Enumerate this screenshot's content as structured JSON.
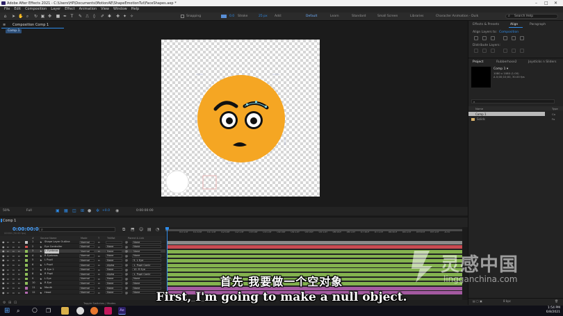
{
  "window": {
    "title": "Adobe After Effects 2021 - C:\\Users\\HP\\Documents\\MotionAE\\ShapeEmotionTut\\FaceShapes.aep *"
  },
  "menu": [
    "File",
    "Edit",
    "Composition",
    "Layer",
    "Effect",
    "Animation",
    "View",
    "Window",
    "Help"
  ],
  "toolbar": {
    "snapping": "Snapping",
    "stroke": "Stroke",
    "stroke_px": "25 px",
    "add": "Add:",
    "workspaces": [
      "Default",
      "Learn",
      "Standard",
      "Small Screen",
      "Libraries",
      "Character Animation - Duik"
    ],
    "active_workspace": "Default",
    "search_placeholder": "Search Help"
  },
  "composition": {
    "tab_label": "Composition Comp 1",
    "crumb": "Comp 1",
    "zoom": "50%",
    "resolution": "Full",
    "timecode": "0:00:00:00",
    "exposure": "+0.0"
  },
  "right_panel": {
    "tabs_top": [
      "Effects & Presets",
      "Align",
      "Paragraph"
    ],
    "active_top": "Align",
    "align_layers_to_label": "Align Layers to:",
    "align_layers_to_value": "Composition",
    "distribute_label": "Distribute Layers:",
    "tabs_mid": [
      "Project",
      "Rubberhose2",
      "Joysticks n Sliders"
    ],
    "active_mid": "Project",
    "comp_name": "Comp 1 ▾",
    "comp_dims": "1080 x 1080 (1.00)",
    "comp_dur": "Δ 0;00;10;00, 30.00 fps",
    "project_columns": [
      "Name",
      "Type"
    ],
    "project_items": [
      {
        "name": "Comp 1",
        "type": "Co",
        "selected": true
      },
      {
        "name": "Solids",
        "type": "Fo",
        "selected": false
      }
    ],
    "bpc": "8 bpc"
  },
  "timeline": {
    "tab": "Comp 1",
    "timecode": "0:00:00:00",
    "timecode_sub": "00000 (30.00 fps)",
    "columns": [
      "#",
      "Source Name",
      "Mode",
      "T",
      "TrkMat",
      "Parent & Link"
    ],
    "ruler": [
      "00:15f",
      "01:00f",
      "01:15f",
      "02:00f",
      "02:15f",
      "03:00f",
      "03:15f",
      "04:00f",
      "04:15f",
      "05:00f",
      "05:15f",
      "06:00f",
      "06:15f",
      "07:00f",
      "07:15f",
      "08:00f",
      "08:15f",
      "09:00f",
      "09:15f",
      "10:0"
    ],
    "layers": [
      {
        "num": "1",
        "name": "Shape Layer Outline",
        "mode": "Normal",
        "trkmat": "",
        "parent": "None",
        "label": "#c4c4c4",
        "track": "#8a8a8a"
      },
      {
        "num": "2",
        "name": "Eye Controller",
        "mode": "Normal",
        "trkmat": "None",
        "parent": "None",
        "label": "#d14d4d",
        "track": "#c94a52"
      },
      {
        "num": "3",
        "name": "L Eyebrow",
        "mode": "Normal",
        "trkmat": "None",
        "parent": "None",
        "label": "#8fbf5a",
        "track": "#84b34f",
        "selected": true
      },
      {
        "num": "4",
        "name": "R Eyebrow",
        "mode": "Normal",
        "trkmat": "None",
        "parent": "None",
        "label": "#8fbf5a",
        "track": "#84b34f"
      },
      {
        "num": "5",
        "name": "L Pupil",
        "mode": "Normal",
        "trkmat": "None",
        "parent": "9. L Eye",
        "label": "#8fbf5a",
        "track": "#84b34f"
      },
      {
        "num": "6",
        "name": "L Pupil",
        "mode": "Normal",
        "trkmat": "Alpha",
        "parent": "1. Pupil Contr",
        "label": "#8fbf5a",
        "track": "#84b34f"
      },
      {
        "num": "7",
        "name": "R Eye 2",
        "mode": "Normal",
        "trkmat": "None",
        "parent": "10. R Eye",
        "label": "#8fbf5a",
        "track": "#84b34f"
      },
      {
        "num": "8",
        "name": "R Pupil",
        "mode": "Normal",
        "trkmat": "Alpha",
        "parent": "1. Pupil Contr",
        "label": "#8fbf5a",
        "track": "#84b34f"
      },
      {
        "num": "9",
        "name": "L Eye",
        "mode": "Normal",
        "trkmat": "None",
        "parent": "None",
        "label": "#8fbf5a",
        "track": "#84b34f"
      },
      {
        "num": "10",
        "name": "R Eye",
        "mode": "Normal",
        "trkmat": "None",
        "parent": "None",
        "label": "#8fbf5a",
        "track": "#84b34f"
      },
      {
        "num": "11",
        "name": "Mouth",
        "mode": "Normal",
        "trkmat": "None",
        "parent": "None",
        "label": "#b36ab0",
        "track": "#a55aa2"
      },
      {
        "num": "12",
        "name": "Head",
        "mode": "Normal",
        "trkmat": "None",
        "parent": "None",
        "label": "#b36ab0",
        "track": "#a55aa2"
      }
    ],
    "footer": "Toggle Switches / Modes"
  },
  "subtitles": {
    "zh": "首先 我要做一个空对象",
    "en": "First, I'm going to make a null object."
  },
  "watermark": {
    "cn": "灵感中国",
    "en": "lingganchina.com"
  },
  "taskbar": {
    "time": "1:54 PM",
    "date": "6/8/2021"
  },
  "colors": {
    "accent": "#2d8ceb",
    "face": "#f5a623",
    "subtitle": "#ffffff"
  }
}
